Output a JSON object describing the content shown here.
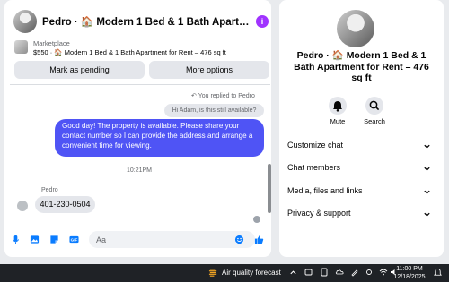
{
  "chat_header": {
    "title": "Pedro · 🏠 Modern 1 Bed & 1 Bath Apartment for ..."
  },
  "listing": {
    "source": "Marketplace",
    "summary": "$550 · 🏠 Modern 1 Bed & 1 Bath Apartment for Rent – 476 sq ft"
  },
  "actions": {
    "mark_pending": "Mark as pending",
    "more_options": "More options"
  },
  "conversation": {
    "reply_note": "You replied to Pedro",
    "quoted_message": "Hi Adam, is this still available?",
    "sent_message": "Good day! The property is available. Please share your contact number so I can provide the address and arrange a convenient time for viewing.",
    "timestamp": "10:21PM",
    "sender_name": "Pedro",
    "received_message": "401-230-0504"
  },
  "composer": {
    "placeholder": "Aa"
  },
  "details": {
    "title": "Pedro · 🏠 Modern 1 Bed & 1 Bath Apartment for Rent – 476 sq ft",
    "mute_label": "Mute",
    "search_label": "Search",
    "sections": [
      "Customize chat",
      "Chat members",
      "Media, files and links",
      "Privacy & support"
    ]
  },
  "taskbar": {
    "weather": "Air quality forecast",
    "time": "11:00 PM",
    "date": "12/18/2025"
  },
  "colors": {
    "accent": "#4f54f5",
    "info": "#a033ff",
    "icon_blue": "#0a7cff"
  },
  "icons": [
    "info-icon",
    "reply-icon",
    "mic-icon",
    "image-icon",
    "sticker-icon",
    "gif-icon",
    "emoji-icon",
    "like-icon",
    "bell-icon",
    "search-icon",
    "chevron-down-icon",
    "weather-icon",
    "network-icon",
    "volume-icon",
    "battery-icon"
  ]
}
